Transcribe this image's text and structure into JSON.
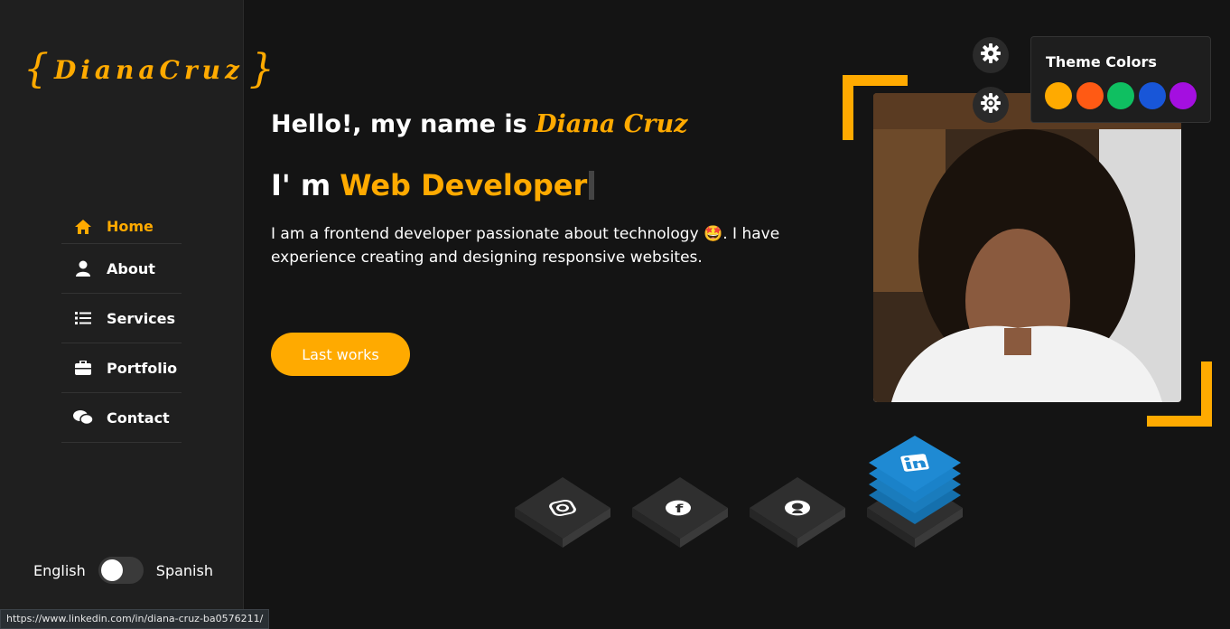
{
  "sidebar": {
    "logo": {
      "brace_open": "{",
      "name": "DianaCruz",
      "brace_close": "}"
    },
    "nav": [
      {
        "label": "Home",
        "icon": "home-icon",
        "active": true
      },
      {
        "label": "About",
        "icon": "user-icon",
        "active": false
      },
      {
        "label": "Services",
        "icon": "list-icon",
        "active": false
      },
      {
        "label": "Portfolio",
        "icon": "briefcase-icon",
        "active": false
      },
      {
        "label": "Contact",
        "icon": "comments-icon",
        "active": false
      }
    ],
    "language": {
      "left": "English",
      "right": "Spanish",
      "state": "English"
    }
  },
  "hero": {
    "hello_prefix": "Hello!, my name is ",
    "hello_name": "Diana Cruz",
    "role_prefix": "I' m",
    "role_highlight": "Web Developer",
    "description_part1": "I am a frontend developer passionate about technology",
    "description_emoji": "🤩",
    "description_part2": ". I have experience creating and designing responsive websites.",
    "cta": "Last works"
  },
  "theme": {
    "title": "Theme Colors",
    "colors": [
      "#ffaa00",
      "#ff5a14",
      "#0fbf61",
      "#1856d8",
      "#a40fe0"
    ]
  },
  "social": [
    {
      "name": "instagram",
      "icon": "instagram-icon"
    },
    {
      "name": "facebook",
      "icon": "facebook-icon"
    },
    {
      "name": "github",
      "icon": "github-icon"
    },
    {
      "name": "linkedin",
      "icon": "linkedin-icon"
    }
  ],
  "status_bar": {
    "url": "https://www.linkedin.com/in/diana-cruz-ba0576211/"
  },
  "colors": {
    "accent": "#ffaa00",
    "background": "#141414",
    "sidebar": "#1f1f1f",
    "linkedin": "#1a82c9"
  }
}
